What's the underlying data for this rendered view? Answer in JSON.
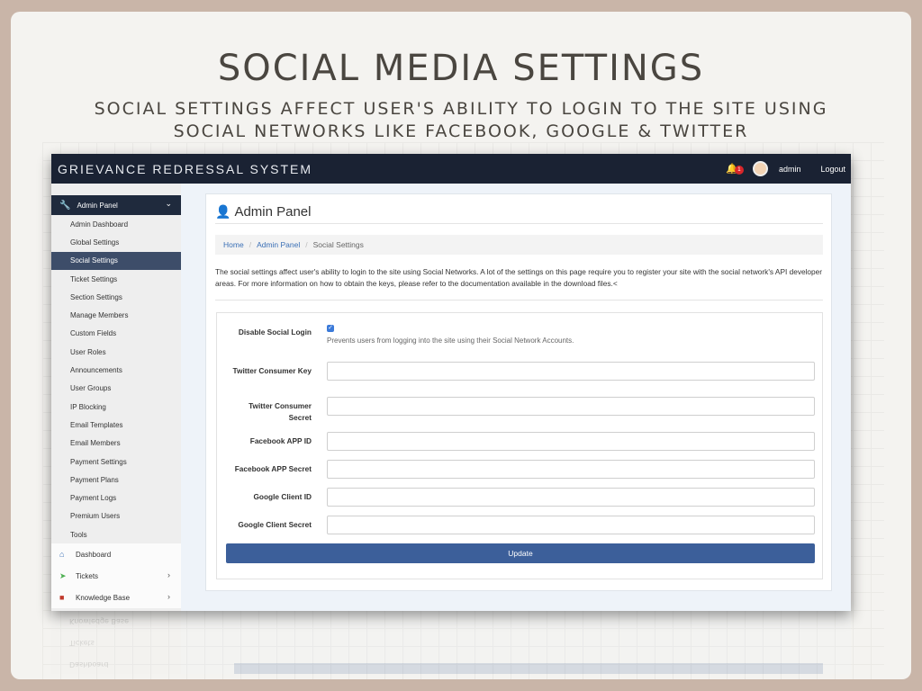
{
  "slide": {
    "title": "SOCIAL MEDIA SETTINGS",
    "subtitle": "SOCIAL SETTINGS AFFECT USER'S ABILITY TO LOGIN TO THE SITE USING SOCIAL NETWORKS LIKE FACEBOOK, GOOGLE & TWITTER"
  },
  "topbar": {
    "brand": "GRIEVANCE REDRESSAL SYSTEM",
    "notification_count": "1",
    "user": "admin",
    "logout": "Logout",
    "bell_icon": "bell-icon",
    "avatar_icon": "avatar-icon"
  },
  "sidebar": {
    "section": "Admin Panel",
    "items": [
      {
        "label": "Admin Dashboard"
      },
      {
        "label": "Global Settings"
      },
      {
        "label": "Social Settings"
      },
      {
        "label": "Ticket Settings"
      },
      {
        "label": "Section Settings"
      },
      {
        "label": "Manage Members"
      },
      {
        "label": "Custom Fields"
      },
      {
        "label": "User Roles"
      },
      {
        "label": "Announcements"
      },
      {
        "label": "User Groups"
      },
      {
        "label": "IP Blocking"
      },
      {
        "label": "Email Templates"
      },
      {
        "label": "Email Members"
      },
      {
        "label": "Payment Settings"
      },
      {
        "label": "Payment Plans"
      },
      {
        "label": "Payment Logs"
      },
      {
        "label": "Premium Users"
      },
      {
        "label": "Tools"
      }
    ],
    "active_item": "Social Settings",
    "nav": [
      {
        "label": "Dashboard",
        "icon": "home-icon"
      },
      {
        "label": "Tickets",
        "icon": "send-icon"
      },
      {
        "label": "Knowledge Base",
        "icon": "book-icon"
      }
    ]
  },
  "panel": {
    "title": "Admin Panel",
    "breadcrumb": [
      "Home",
      "Admin Panel",
      "Social Settings"
    ],
    "intro": "The social settings affect user's ability to login to the site using Social Networks. A lot of the settings on this page require you to register your site with the social network's API developer areas. For more information on how to obtain the keys, please refer to the documentation available in the download files.<"
  },
  "form": {
    "disable_social_label": "Disable Social Login",
    "disable_social_checked": true,
    "disable_social_help": "Prevents users from logging into the site using their Social Network Accounts.",
    "twitter_key_label": "Twitter Consumer Key",
    "twitter_key_value": "",
    "twitter_secret_label": "Twitter Consumer Secret",
    "twitter_secret_value": "",
    "facebook_id_label": "Facebook APP ID",
    "facebook_id_value": "",
    "facebook_secret_label": "Facebook APP Secret",
    "facebook_secret_value": "",
    "google_id_label": "Google Client ID",
    "google_id_value": "",
    "google_secret_label": "Google Client Secret",
    "google_secret_value": "",
    "update_label": "Update"
  },
  "colors": {
    "topbar": "#1a2233",
    "active_item": "#3d4d69",
    "button": "#3c5f9a",
    "badge": "#d9262a"
  }
}
